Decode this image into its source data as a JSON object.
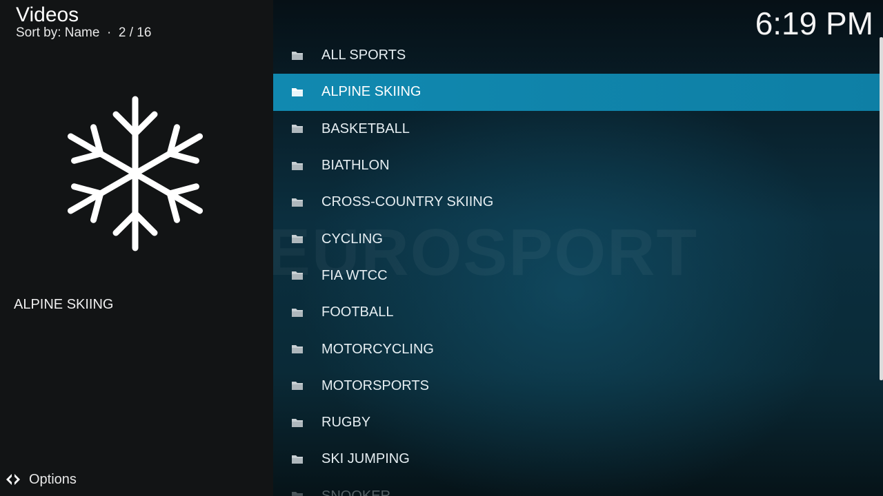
{
  "header": {
    "title": "Videos",
    "sort_line": "Sort by: Name  ·  2 / 16"
  },
  "clock": "6:19 PM",
  "info_panel": {
    "selected_label": "ALPINE SKIING",
    "thumbnail_icon": "snowflake-icon"
  },
  "watermark": "EUROSPORT",
  "footer": {
    "options_label": "Options",
    "options_icon": "options-arrows-icon"
  },
  "list": {
    "items": [
      {
        "label": "ALL SPORTS"
      },
      {
        "label": "ALPINE SKIING"
      },
      {
        "label": "BASKETBALL"
      },
      {
        "label": "BIATHLON"
      },
      {
        "label": "CROSS-COUNTRY SKIING"
      },
      {
        "label": "CYCLING"
      },
      {
        "label": "FIA WTCC"
      },
      {
        "label": "FOOTBALL"
      },
      {
        "label": "MOTORCYCLING"
      },
      {
        "label": "MOTORSPORTS"
      },
      {
        "label": "RUGBY"
      },
      {
        "label": "SKI JUMPING"
      },
      {
        "label": "SNOOKER"
      }
    ],
    "selected_index": 1,
    "item_icon": "folder-icon"
  },
  "colors": {
    "selection": "#1186ad",
    "left_panel": "#121415"
  }
}
